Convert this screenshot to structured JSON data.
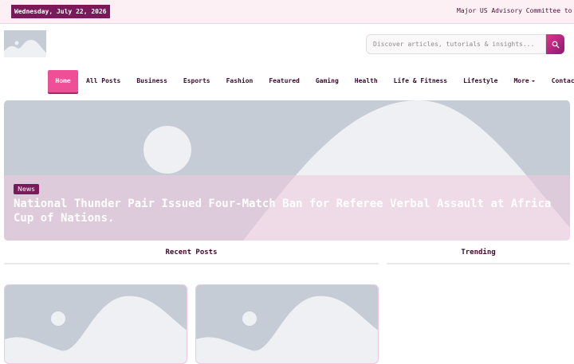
{
  "topbar": {
    "date": "Wednesday, July 22, 2026",
    "ticker": "Major US Advisory Committee to Ca"
  },
  "search": {
    "placeholder": "Discover articles, tutorials & insights...",
    "icon": "search-icon"
  },
  "nav": {
    "items": [
      {
        "label": "Home",
        "active": true
      },
      {
        "label": "All Posts"
      },
      {
        "label": "Business"
      },
      {
        "label": "Esports"
      },
      {
        "label": "Fashion"
      },
      {
        "label": "Featured"
      },
      {
        "label": "Gaming"
      },
      {
        "label": "Health"
      },
      {
        "label": "Life & Fitness"
      },
      {
        "label": "Lifestyle"
      },
      {
        "label": "More"
      },
      {
        "label": "Contact Us"
      }
    ]
  },
  "hero": {
    "tag": "News",
    "title": "National Thunder Pair Issued Four-Match Ban for Referee Verbal Assault at Africa Cup of Nations."
  },
  "sections": {
    "recent": "Recent Posts",
    "trending": "Trending"
  },
  "colors": {
    "accent": "#ef4f97",
    "brand_dark": "#7a1a5a",
    "placeholder": "#c5ccd5"
  }
}
